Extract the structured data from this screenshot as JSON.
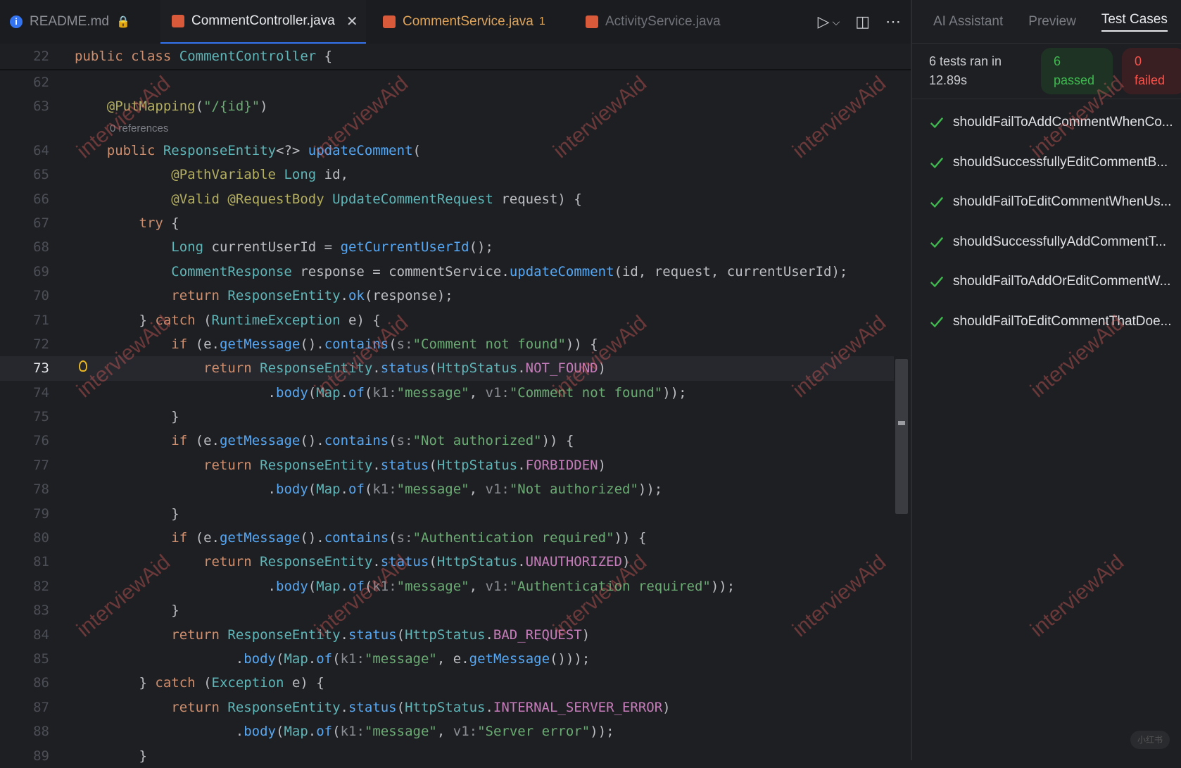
{
  "tabs": {
    "readme": "README.md",
    "controller": "CommentController.java",
    "service": "CommentService.java",
    "service_badge": "1",
    "activity": "ActivityService.java"
  },
  "sticky": {
    "line": "22",
    "text": "public class CommentController {"
  },
  "hint": "0 references",
  "lines": [
    {
      "n": "62",
      "t": ""
    },
    {
      "n": "63",
      "t": "    @PutMapping(\"/{id}\")"
    },
    {
      "n": "64",
      "t": "    public ResponseEntity<?> updateComment("
    },
    {
      "n": "65",
      "t": "            @PathVariable Long id,"
    },
    {
      "n": "66",
      "t": "            @Valid @RequestBody UpdateCommentRequest request) {"
    },
    {
      "n": "67",
      "t": "        try {"
    },
    {
      "n": "68",
      "t": "            Long currentUserId = getCurrentUserId();"
    },
    {
      "n": "69",
      "t": "            CommentResponse response = commentService.updateComment(id, request, currentUserId);"
    },
    {
      "n": "70",
      "t": "            return ResponseEntity.ok(response);"
    },
    {
      "n": "71",
      "t": "        } catch (RuntimeException e) {"
    },
    {
      "n": "72",
      "t": "            if (e.getMessage().contains(s:\"Comment not found\")) {"
    },
    {
      "n": "73",
      "t": "                return ResponseEntity.status(HttpStatus.NOT_FOUND)"
    },
    {
      "n": "74",
      "t": "                        .body(Map.of(k1:\"message\", v1:\"Comment not found\"));"
    },
    {
      "n": "75",
      "t": "            }"
    },
    {
      "n": "76",
      "t": "            if (e.getMessage().contains(s:\"Not authorized\")) {"
    },
    {
      "n": "77",
      "t": "                return ResponseEntity.status(HttpStatus.FORBIDDEN)"
    },
    {
      "n": "78",
      "t": "                        .body(Map.of(k1:\"message\", v1:\"Not authorized\"));"
    },
    {
      "n": "79",
      "t": "            }"
    },
    {
      "n": "80",
      "t": "            if (e.getMessage().contains(s:\"Authentication required\")) {"
    },
    {
      "n": "81",
      "t": "                return ResponseEntity.status(HttpStatus.UNAUTHORIZED)"
    },
    {
      "n": "82",
      "t": "                        .body(Map.of(k1:\"message\", v1:\"Authentication required\"));"
    },
    {
      "n": "83",
      "t": "            }"
    },
    {
      "n": "84",
      "t": "            return ResponseEntity.status(HttpStatus.BAD_REQUEST)"
    },
    {
      "n": "85",
      "t": "                    .body(Map.of(k1:\"message\", e.getMessage()));"
    },
    {
      "n": "86",
      "t": "        } catch (Exception e) {"
    },
    {
      "n": "87",
      "t": "            return ResponseEntity.status(HttpStatus.INTERNAL_SERVER_ERROR)"
    },
    {
      "n": "88",
      "t": "                    .body(Map.of(k1:\"message\", v1:\"Server error\"));"
    },
    {
      "n": "89",
      "t": "        }"
    }
  ],
  "current_line": "73",
  "panel": {
    "tabs": [
      "AI Assistant",
      "Preview",
      "Test Cases"
    ],
    "active_tab": "Test Cases",
    "summary": "6 tests ran in 12.89s",
    "passed_count": "6",
    "passed_label": "passed",
    "failed_count": "0",
    "failed_label": "failed",
    "tests": [
      "shouldFailToAddCommentWhenCo...",
      "shouldSuccessfullyEditCommentB...",
      "shouldFailToEditCommentWhenUs...",
      "shouldSuccessfullyAddCommentT...",
      "shouldFailToAddOrEditCommentW...",
      "shouldFailToEditCommentThatDoe..."
    ],
    "test_status": "passed"
  },
  "watermark": "interviewAid",
  "logo_text": "小红书",
  "colors": {
    "accent": "#3574f0",
    "passed": "#3fb950",
    "failed": "#f85149"
  }
}
